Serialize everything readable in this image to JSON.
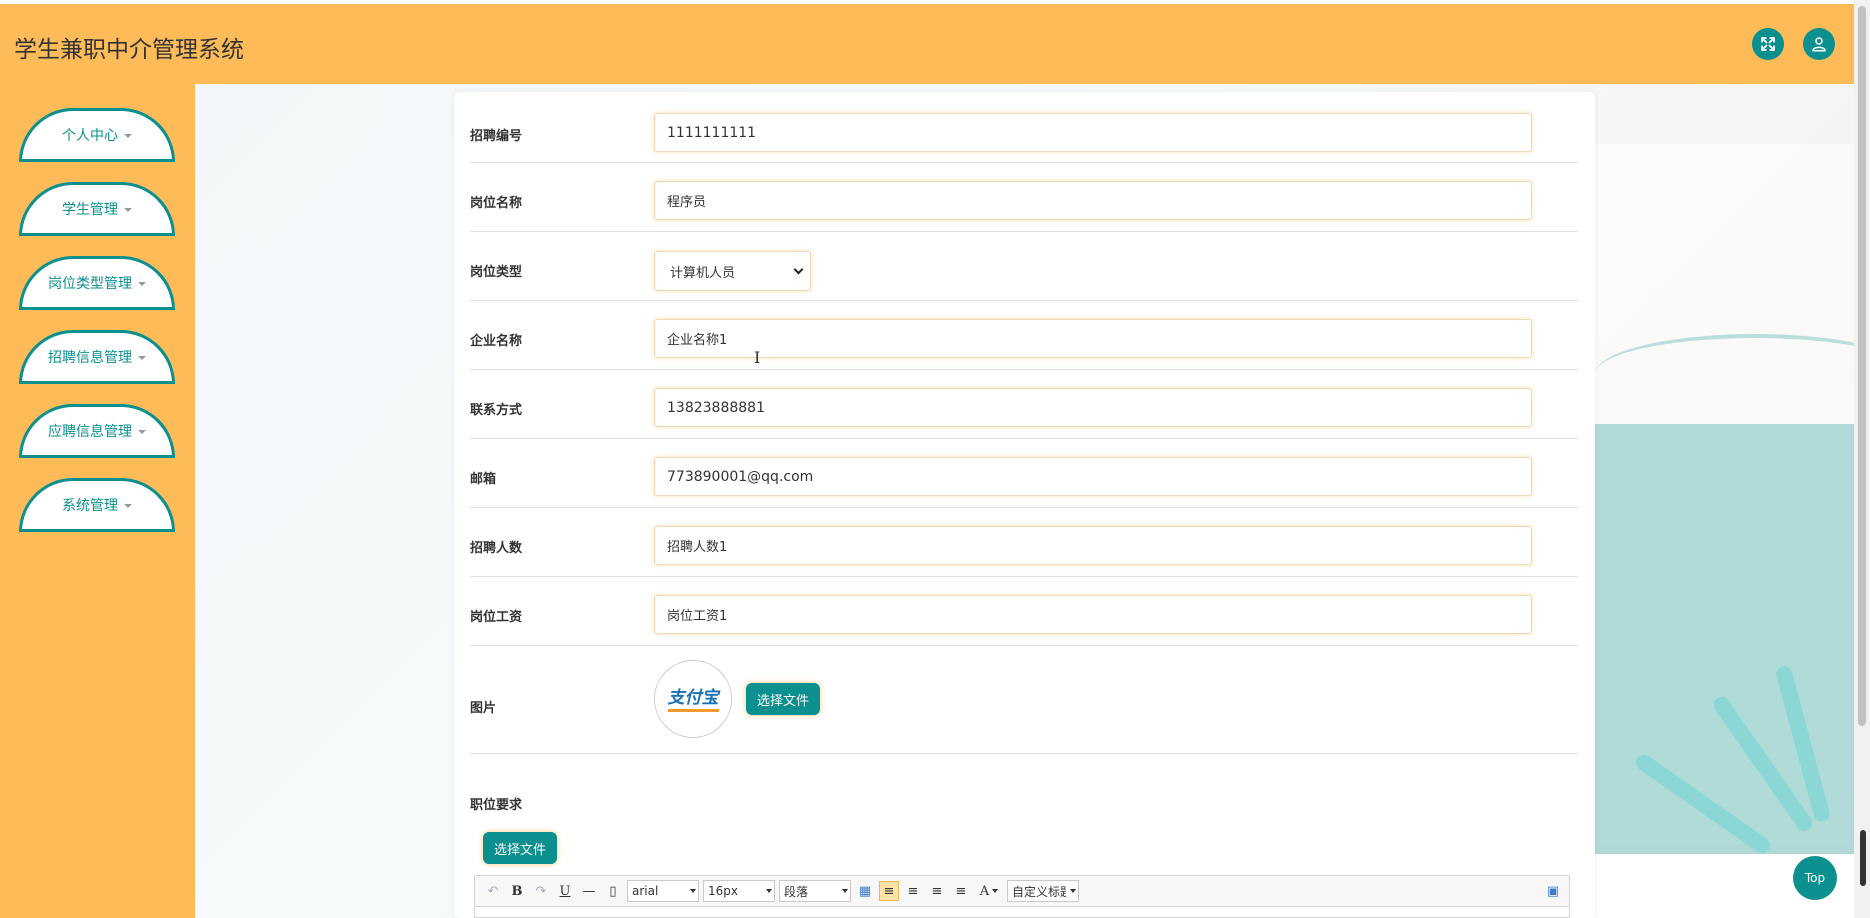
{
  "app": {
    "title": "学生兼职中介管理系统"
  },
  "header": {
    "fullscreen_icon": "expand-icon",
    "user_icon": "user-icon"
  },
  "sidebar": {
    "items": [
      {
        "label": "个人中心"
      },
      {
        "label": "学生管理"
      },
      {
        "label": "岗位类型管理"
      },
      {
        "label": "招聘信息管理"
      },
      {
        "label": "应聘信息管理"
      },
      {
        "label": "系统管理"
      }
    ]
  },
  "form": {
    "recruit_no": {
      "label": "招聘编号",
      "value": "1111111111"
    },
    "position_name": {
      "label": "岗位名称",
      "value": "程序员"
    },
    "position_type": {
      "label": "岗位类型",
      "value": "计算机人员"
    },
    "company_name": {
      "label": "企业名称",
      "value": "企业名称1"
    },
    "contact": {
      "label": "联系方式",
      "value": "13823888881"
    },
    "email": {
      "label": "邮箱",
      "value": "773890001@qq.com"
    },
    "headcount": {
      "label": "招聘人数",
      "value": "招聘人数1"
    },
    "salary": {
      "label": "岗位工资",
      "value": "岗位工资1"
    },
    "image": {
      "label": "图片",
      "button": "选择文件",
      "logo_text": "支付宝"
    },
    "requirements": {
      "label": "职位要求",
      "button": "选择文件"
    }
  },
  "editor": {
    "font_family": "arial",
    "font_size": "16px",
    "paragraph": "段落",
    "custom_title": "自定义标题",
    "bold": "B",
    "underline": "U",
    "font_color": "A"
  },
  "top_button": {
    "label": "Top"
  },
  "colors": {
    "primary": "#0B8F8F",
    "accent": "#FEBB57"
  }
}
